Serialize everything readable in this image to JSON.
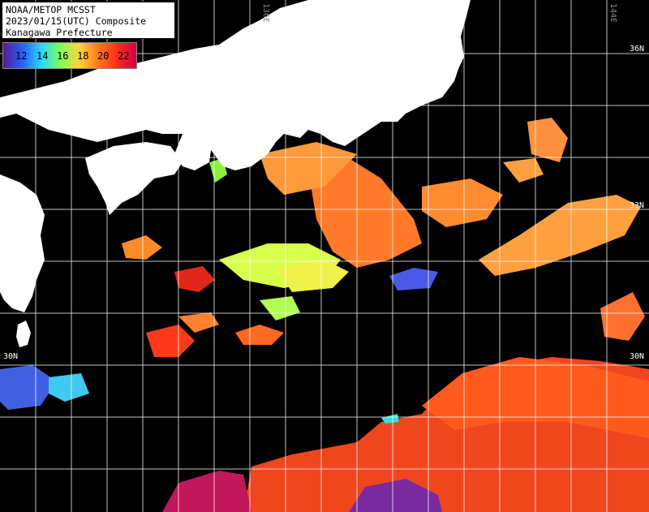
{
  "title": {
    "line1": "NOAA/METOP MCSST",
    "line2": "2023/01/15(UTC) Composite",
    "line3": "Kanagawa Prefecture"
  },
  "legend": {
    "labels": [
      "12",
      "14",
      "16",
      "18",
      "20",
      "22"
    ],
    "colors": [
      "#5a1a8c",
      "#2a5cff",
      "#27d7ff",
      "#7dff5a",
      "#ffd43a",
      "#ff7a1a",
      "#ff2a1a",
      "#d0004a"
    ]
  },
  "grid": {
    "lat_labels": [
      "36N",
      "33N",
      "30N",
      "30N"
    ],
    "lon_labels": [
      "136E",
      "144E"
    ]
  },
  "colors": {
    "land": "#ffffff",
    "ocean_nodata": "#000000",
    "grid": "#ffffff"
  }
}
